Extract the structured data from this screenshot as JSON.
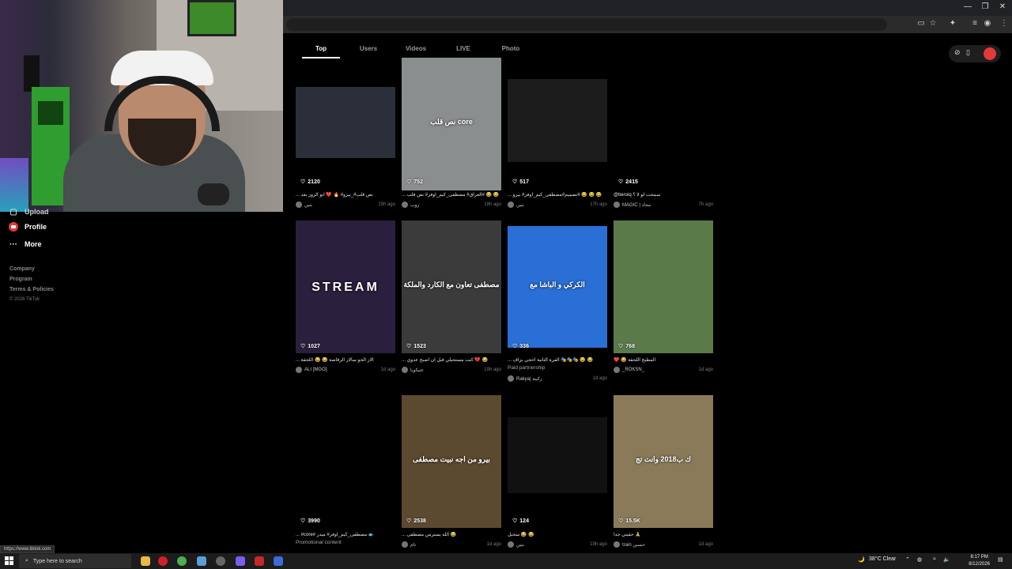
{
  "browser": {
    "status_url": "https://www.tiktok.com"
  },
  "sidebar": {
    "partial_item": "Upload",
    "items": [
      {
        "label": "Profile",
        "icon": "profile-icon"
      },
      {
        "label": "More",
        "icon": "more-icon"
      }
    ],
    "footer_links": [
      "Company",
      "Program",
      "Terms & Policies"
    ],
    "copyright": "© 2026 TikTok"
  },
  "tabs": [
    "Top",
    "Users",
    "Videos",
    "LIVE",
    "Photo"
  ],
  "active_tab": "Top",
  "cards": [
    {
      "likes": "2120",
      "caption": "... نص قلب#_بيرو# 🔥 ❤️ ابو الزوز بعد",
      "author": "بنين",
      "ago": "15h ago",
      "sub": "",
      "thumb_bg": "#2a2f3a",
      "thumb_text": ""
    },
    {
      "likes": "752",
      "caption": "... العراق# مصطفى_كيم_اوفر# نص قلب# 😂 😂",
      "author": "زوب",
      "ago": "18h ago",
      "sub": "",
      "thumb_bg": "#8b8e8f",
      "thumb_text": "نص قلب core"
    },
    {
      "likes": "517",
      "caption": "... تصميم#مصطفى_كيم_اوفر# بيرو# 😂 😂 😂",
      "author": "بنين",
      "ago": "17h ago",
      "sub": "",
      "thumb_bg": "#1c1c1c",
      "thumb_text": ""
    },
    {
      "likes": "2415",
      "caption": "@beroiq سمحت لو لا ؟",
      "author": "MAGIC | مجاد",
      "ago": "7h ago",
      "sub": "",
      "thumb_bg": "#000000",
      "thumb_text": ""
    },
    {
      "likes": "1027",
      "caption": "... الاز الحو سالار الرقاصة 😂 😂 اللحقة",
      "author": "ALI [MGO]",
      "ago": "1d ago",
      "sub": "",
      "thumb_bg": "#2a1f3d",
      "thumb_text": "STREAM"
    },
    {
      "likes": "1523",
      "caption": "... كنت مستحيلي قبل ان اصبح عدوي 💔 😂",
      "author": "عثيكوبا",
      "ago": "19h ago",
      "sub": "",
      "thumb_bg": "#3b3b3b",
      "thumb_text": "مصطفى تعاون مع الكارد والملكة"
    },
    {
      "likes": "336",
      "caption": "... الفرة الثانية احجي بزاف 🎭🎭🎭 😂 😂",
      "author": "Rakya| ركيبة",
      "ago": "1d ago",
      "sub": "Paid partnership",
      "thumb_bg": "#2a6fd6",
      "thumb_text": "الكركي و الباشا مع"
    },
    {
      "likes": "768",
      "caption": "❤️ 😂 المطبخ اللحقة",
      "author": "_ROKSN_",
      "ago": "1d ago",
      "sub": "",
      "thumb_bg": "#5a7a4a",
      "thumb_text": ""
    },
    {
      "likes": "3990",
      "caption": "... #core# مصطفى_كيم_اوفر# ميدز 🐟",
      "author": "",
      "ago": "",
      "sub": "Promotional content",
      "thumb_bg": "#000000",
      "thumb_text": ""
    },
    {
      "likes": "2538",
      "caption": "... الله يسترمن مصطفى 😂",
      "author": "نام",
      "ago": "1d ago",
      "sub": "",
      "thumb_bg": "#5c4a30",
      "thumb_text": "بيرو من اجه نبيت مصطفى"
    },
    {
      "likes": "124",
      "caption": "سحيل 😂 😂",
      "author": "بنين",
      "ago": "19h ago",
      "sub": "",
      "thumb_bg": "#111111",
      "thumb_text": ""
    },
    {
      "likes": "15.5K",
      "caption": "حقيتي جدا 🙏",
      "author": "train حسين",
      "ago": "1d ago",
      "sub": "",
      "thumb_bg": "#8a7a5a",
      "thumb_text": "ك ب2018 وانت تج"
    }
  ],
  "taskbar": {
    "search_placeholder": "Type here to search",
    "weather": "38°C  Clear",
    "time": "8:17 PM",
    "date": "8/12/2026"
  }
}
